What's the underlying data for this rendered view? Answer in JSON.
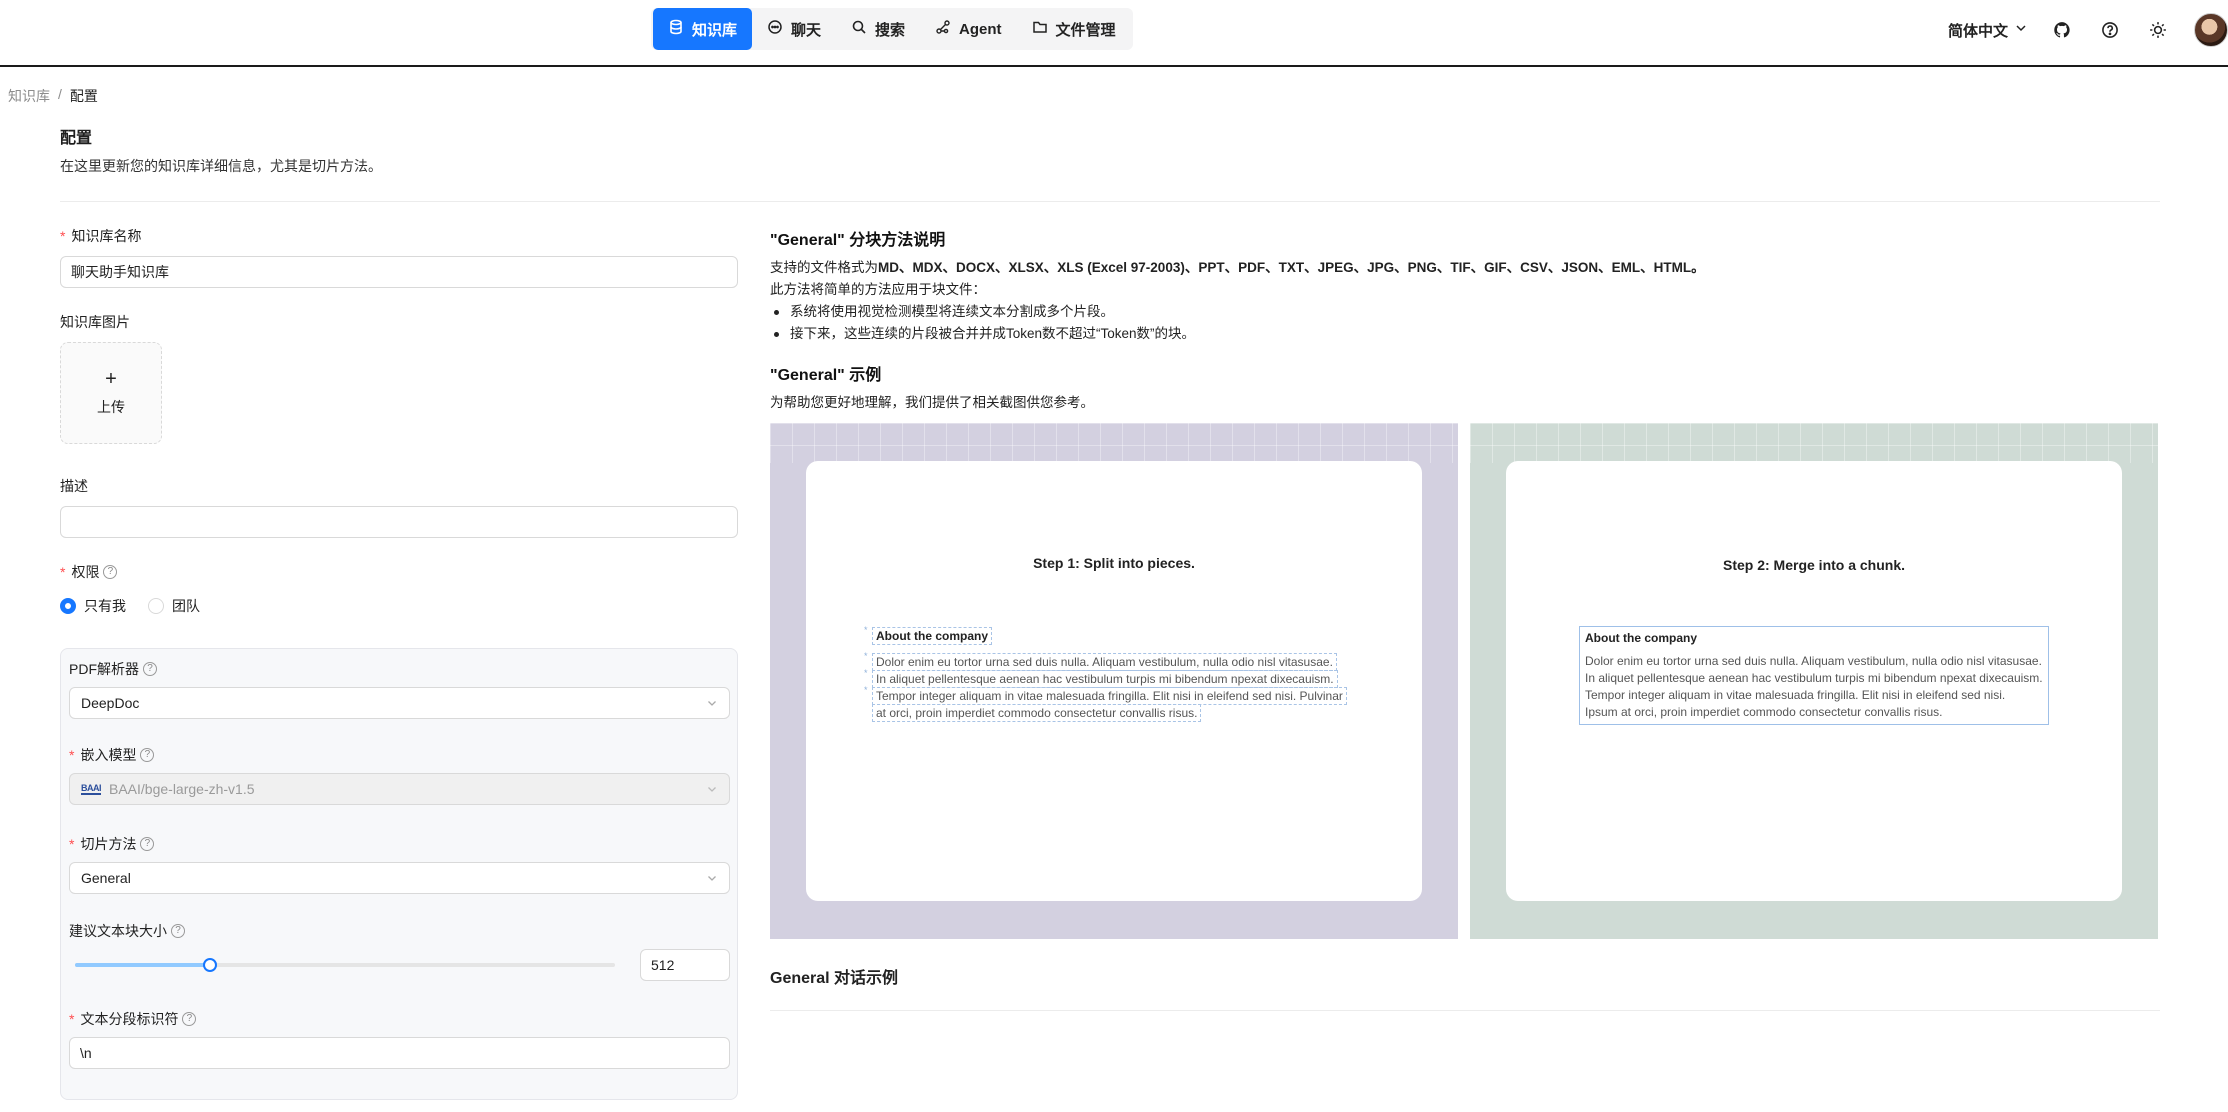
{
  "nav": {
    "items": [
      {
        "label": "知识库",
        "icon": "database-icon",
        "active": true
      },
      {
        "label": "聊天",
        "icon": "chat-icon",
        "active": false
      },
      {
        "label": "搜索",
        "icon": "search-icon",
        "active": false
      },
      {
        "label": "Agent",
        "icon": "agent-icon",
        "active": false
      },
      {
        "label": "文件管理",
        "icon": "folder-icon",
        "active": false
      }
    ]
  },
  "header": {
    "language": "简体中文",
    "icons": [
      "github-icon",
      "help-circle-icon",
      "sun-icon",
      "avatar"
    ]
  },
  "breadcrumb": {
    "parent": "知识库",
    "separator": "/",
    "current": "配置"
  },
  "page": {
    "title": "配置",
    "subtitle": "在这里更新您的知识库详细信息，尤其是切片方法。"
  },
  "form": {
    "name": {
      "label": "知识库名称",
      "value": "聊天助手知识库"
    },
    "image": {
      "label": "知识库图片",
      "upload_plus": "+",
      "upload_label": "上传"
    },
    "description": {
      "label": "描述",
      "value": ""
    },
    "permission": {
      "label": "权限",
      "help": "?",
      "options": [
        "只有我",
        "团队"
      ],
      "selected": "只有我"
    },
    "pdf_parser": {
      "label": "PDF解析器",
      "help": "?",
      "value": "DeepDoc"
    },
    "embedding": {
      "label": "嵌入模型",
      "help": "?",
      "logo_text": "BAAI",
      "value": "BAAI/bge-large-zh-v1.5"
    },
    "chunk_method": {
      "label": "切片方法",
      "help": "?",
      "value": "General"
    },
    "chunk_size": {
      "label": "建议文本块大小",
      "help": "?",
      "value": "512",
      "slider_fraction": 0.25
    },
    "delimiter": {
      "label": "文本分段标识符",
      "help": "?",
      "value": "\\n"
    }
  },
  "explain": {
    "title": "\"General\" 分块方法说明",
    "formats_prefix": "支持的文件格式为",
    "formats": "MD、MDX、DOCX、XLSX、XLS (Excel 97-2003)、PPT、PDF、TXT、JPEG、JPG、PNG、TIF、GIF、CSV、JSON、EML、HTML。",
    "intro": "此方法将简单的方法应用于块文件：",
    "bullets": [
      "系统将使用视觉检测模型将连续文本分割成多个片段。",
      "接下来，这些连续的片段被合并并成Token数不超过“Token数”的块。"
    ],
    "example_title": "\"General\" 示例",
    "example_sub": "为帮助您更好地理解，我们提供了相关截图供您参考。",
    "dialog_title": "General 对话示例"
  },
  "examples": {
    "step1": {
      "title": "Step 1: Split into pieces.",
      "heading": "About the company",
      "lines": [
        "Dolor enim eu tortor urna sed duis nulla. Aliquam vestibulum, nulla odio nisl vitasusae.",
        "In aliquet pellentesque aenean hac vestibulum turpis mi bibendum npexat dixecauism.",
        "Tempor integer aliquam in vitae malesuada fringilla. Elit nisi in eleifend sed nisi. Pulvinar",
        "at orci, proin imperdiet commodo consectetur convallis risus."
      ]
    },
    "step2": {
      "title": "Step 2: Merge into a chunk.",
      "heading": "About the company",
      "lines": [
        "Dolor enim eu tortor urna sed duis nulla. Aliquam vestibulum, nulla odio nisl vitasusae.",
        "In aliquet pellentesque aenean hac vestibulum turpis mi bibendum npexat dixecauism.",
        "Tempor integer aliquam in vitae malesuada fringilla. Elit nisi in eleifend sed nisi.",
        "Ipsum at orci, proin imperdiet commodo consectetur convallis risus."
      ]
    }
  },
  "colors": {
    "accent": "#1677ff",
    "required": "#ff4d4f",
    "example1_bg": "#d3d0e0",
    "example2_bg": "#cfdbd5"
  }
}
